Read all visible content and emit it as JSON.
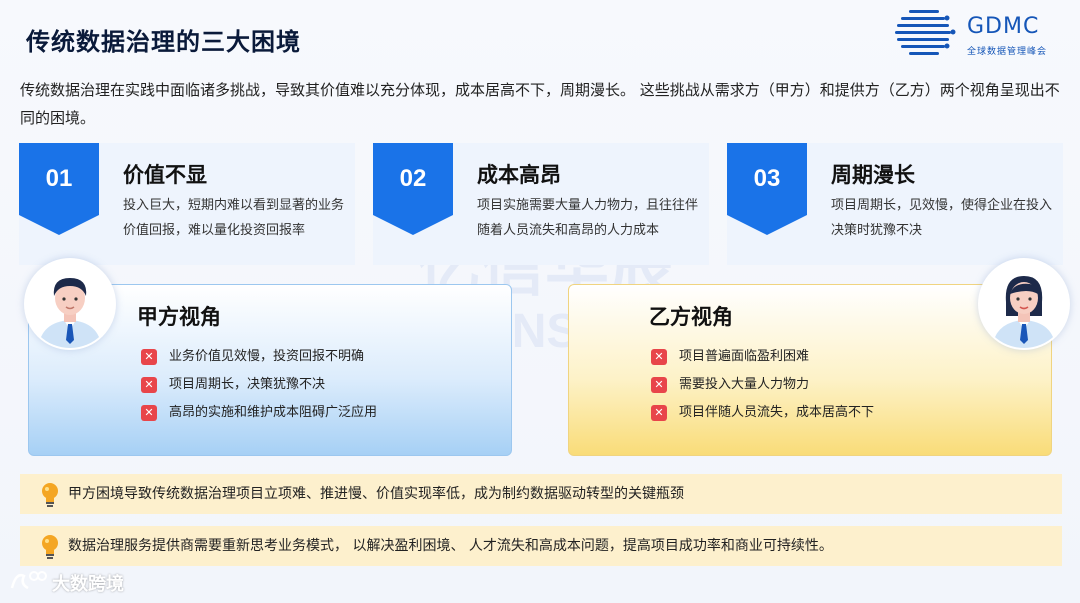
{
  "slide": {
    "title": "传统数据治理的三大困境",
    "intro": "传统数据治理在实践中面临诸多挑战，导致其价值难以充分体现，成本居高不下，周期漫长。 这些挑战从需求方（甲方）和提供方（乙方）两个视角呈现出不同的困境。"
  },
  "logo": {
    "name": "GDMC",
    "subtitle": "全球数据管理峰会"
  },
  "watermark": {
    "line1": "亿信华辰",
    "line2": "ESENSOFT"
  },
  "cards": [
    {
      "number": "01",
      "title": "价值不显",
      "desc": "投入巨大，短期内难以看到显著的业务价值回报，难以量化投资回报率"
    },
    {
      "number": "02",
      "title": "成本高昂",
      "desc": "项目实施需要大量人力物力，且往往伴随着人员流失和高昂的人力成本"
    },
    {
      "number": "03",
      "title": "周期漫长",
      "desc": "项目周期长，见效慢，使得企业在投入决策时犹豫不决"
    }
  ],
  "perspectives": {
    "client": {
      "title": "甲方视角",
      "items": [
        "业务价值见效慢，投资回报不明确",
        "项目周期长，决策犹豫不决",
        "高昂的实施和维护成本阻碍广泛应用"
      ]
    },
    "vendor": {
      "title": "乙方视角",
      "items": [
        "项目普遍面临盈利困难",
        "需要投入大量人力物力",
        "项目伴随人员流失，成本居高不下"
      ]
    }
  },
  "notes": [
    "甲方困境导致传统数据治理项目立项难、推进慢、价值实现率低，成为制约数据驱动转型的关键瓶颈",
    "数据治理服务提供商需要重新思考业务模式， 以解决盈利困境、 人才流失和高成本问题，提高项目成功率和商业可持续性。"
  ],
  "footer": {
    "brand": "大数跨境"
  },
  "colors": {
    "accent_blue": "#1a73e8",
    "card_bg": "#eef4fd",
    "note_bg": "#fdf0cd",
    "x_red": "#e8454a"
  }
}
